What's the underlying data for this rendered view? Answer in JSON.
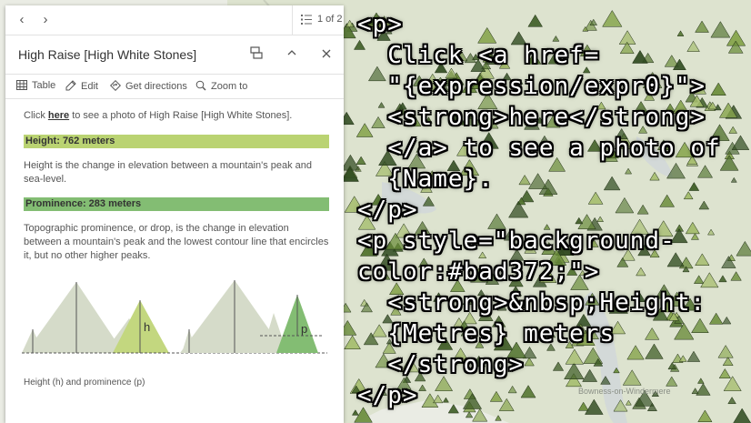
{
  "nav": {
    "prev_icon": "chevron-left-icon",
    "next_icon": "chevron-right-icon",
    "feature_count": "1 of 2"
  },
  "popup": {
    "title": "High Raise [High White Stones]",
    "actions": [
      {
        "label": "Table",
        "icon": "table-icon"
      },
      {
        "label": "Edit",
        "icon": "edit-icon"
      },
      {
        "label": "Get directions",
        "icon": "directions-icon"
      },
      {
        "label": "Zoom to",
        "icon": "zoom-to-icon"
      }
    ],
    "intro_prefix": "Click ",
    "intro_link": "here",
    "intro_suffix": " to see a photo of High Raise [High White Stones].",
    "height_bar": {
      "text": "Height: 762 meters",
      "color": "#bad372"
    },
    "height_desc": "Height is the change in elevation between a mountain's peak and sea-level.",
    "prominence_bar": {
      "text": "Prominence: 283 meters",
      "color": "#83bd73"
    },
    "prominence_desc": "Topographic prominence, or drop, is the change in elevation between a mountain's peak and the lowest contour line that encircles it, but no other higher peaks.",
    "diagram": {
      "label_h": "h",
      "label_p": "p",
      "caption": "Height (h) and prominence (p)"
    }
  },
  "code_overlay": [
    "<p>",
    "  Click <a href=",
    "  \"{expression/expr0}\">",
    "  <strong>here</strong>",
    "  </a> to see a photo of",
    "  {Name}.",
    "</p>",
    "<p style=\"background-",
    "color:#bad372;\">",
    "  <strong>&nbsp;Height:",
    "  {Metres} meters",
    "  </strong>",
    "</p>"
  ],
  "map_label": "Bowness-on-Windermere"
}
